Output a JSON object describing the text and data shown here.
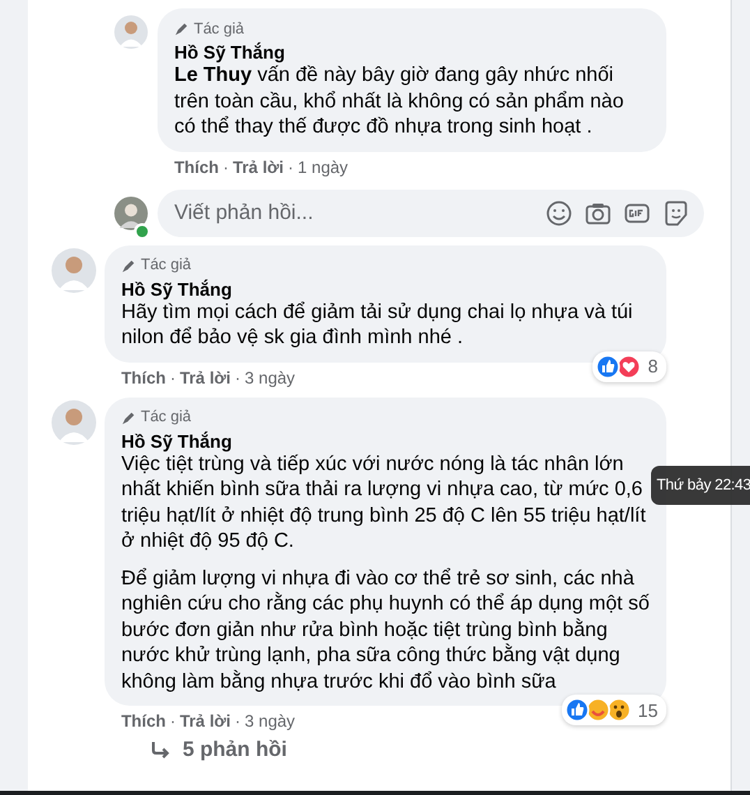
{
  "replies": [
    {
      "badge": "Tác giả",
      "name": "Hồ Sỹ Thắng",
      "paragraphs": [
        "**Le Thuy** vấn đề này bây giờ đang gây nhức nhối trên toàn cầu, khổ nhất là không có sản phẩm nào có thể thay thế được đồ nhựa trong sinh hoạt ."
      ],
      "actions": [
        {
          "kind": "link",
          "text": "Thích"
        },
        {
          "kind": "separator",
          "text": "·"
        },
        {
          "kind": "link",
          "text": "Trả lời"
        },
        {
          "kind": "separator",
          "text": "·"
        },
        {
          "kind": "time",
          "text": "1 ngày"
        }
      ]
    }
  ],
  "reply_box": {
    "placeholder": "Viết phản hồi...",
    "online": true
  },
  "comments": [
    {
      "badge": "Tác giả",
      "name": "Hồ Sỹ Thắng",
      "paragraphs": [
        "Hãy tìm mọi cách để giảm tải sử dụng chai lọ nhựa và túi nilon để bảo vệ sk gia đình mình nhé ."
      ],
      "reactions": [
        {
          "kind": "like"
        },
        {
          "kind": "love"
        }
      ],
      "reaction_count": "8",
      "actions": [
        {
          "kind": "link",
          "text": "Thích"
        },
        {
          "kind": "separator",
          "text": "·"
        },
        {
          "kind": "link",
          "text": "Trả lời"
        },
        {
          "kind": "separator",
          "text": "·"
        },
        {
          "kind": "time",
          "text": "3 ngày"
        }
      ]
    },
    {
      "badge": "Tác giả",
      "name": "Hồ Sỹ Thắng",
      "paragraphs": [
        "Việc tiệt trùng và tiếp xúc với nước nóng là tác nhân lớn nhất khiến bình sữa thải ra lượng vi nhựa cao, từ mức 0,6 triệu hạt/lít ở nhiệt độ trung bình 25 độ C lên 55 triệu hạt/lít ở nhiệt độ 95 độ C.",
        "Để giảm lượng vi nhựa đi vào cơ thể trẻ sơ sinh, các nhà nghiên cứu cho rằng các phụ huynh có thể áp dụng một số bước đơn giản như rửa bình hoặc tiệt trùng bình bằng nước khử trùng lạnh, pha sữa công thức bằng vật dụng không làm bằng nhựa trước khi đổ vào bình sữa"
      ],
      "reactions": [
        {
          "kind": "like"
        },
        {
          "kind": "care"
        },
        {
          "kind": "wow"
        }
      ],
      "reaction_count": "15",
      "actions": [
        {
          "kind": "link",
          "text": "Thích"
        },
        {
          "kind": "separator",
          "text": "·"
        },
        {
          "kind": "link",
          "text": "Trả lời"
        },
        {
          "kind": "separator",
          "text": "·"
        },
        {
          "kind": "time",
          "text": "3 ngày"
        }
      ]
    }
  ],
  "replies_link": "5 phản hồi",
  "tooltip": "Thứ bảy 22:43"
}
